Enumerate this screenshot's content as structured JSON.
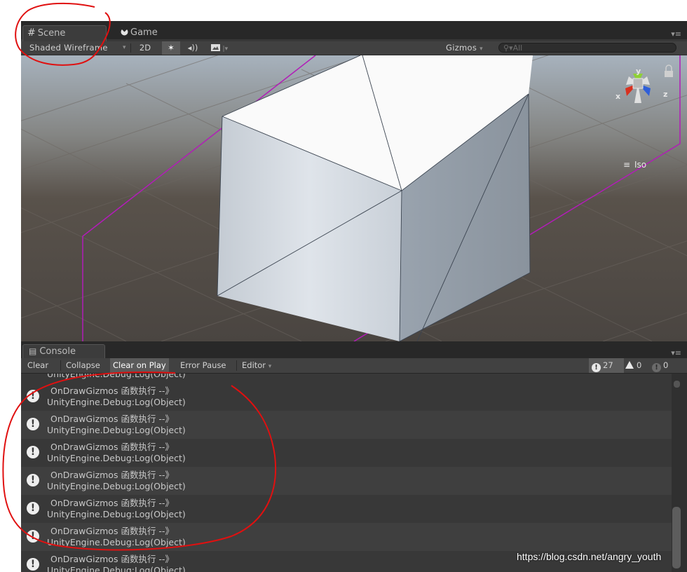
{
  "scene_panel": {
    "tabs": [
      {
        "label": "Scene",
        "icon": "grid-icon",
        "active": true
      },
      {
        "label": "Game",
        "icon": "pacman-icon",
        "active": false
      }
    ],
    "toolbar": {
      "shading_mode": "Shaded Wireframe",
      "mode_2d": "2D",
      "lighting_icon": "sun-icon",
      "audio_icon": "speaker-icon",
      "effects_icon": "image-icon",
      "gizmos_label": "Gizmos",
      "search_placeholder": "All"
    },
    "orientation_gizmo": {
      "axes": [
        "y",
        "x",
        "z"
      ],
      "projection_label": "Iso",
      "axis_colors": {
        "x": "#d9311f",
        "y": "#8fd035",
        "z": "#2f5fd8"
      }
    }
  },
  "console_panel": {
    "tab_label": "Console",
    "toolbar": {
      "clear": "Clear",
      "collapse": "Collapse",
      "clear_on_play": "Clear on Play",
      "error_pause": "Error Pause",
      "editor": "Editor"
    },
    "counts": {
      "log": "27",
      "warning": "0",
      "error": "0"
    },
    "partial_top_line": "UnityEngine.Debug:Log(Object)",
    "entries": [
      {
        "message": "OnDrawGizmos 函数执行 --》",
        "trace": "UnityEngine.Debug:Log(Object)"
      },
      {
        "message": "OnDrawGizmos 函数执行 --》",
        "trace": "UnityEngine.Debug:Log(Object)"
      },
      {
        "message": "OnDrawGizmos 函数执行 --》",
        "trace": "UnityEngine.Debug:Log(Object)"
      },
      {
        "message": "OnDrawGizmos 函数执行 --》",
        "trace": "UnityEngine.Debug:Log(Object)"
      },
      {
        "message": "OnDrawGizmos 函数执行 --》",
        "trace": "UnityEngine.Debug:Log(Object)"
      },
      {
        "message": "OnDrawGizmos 函数执行 --》",
        "trace": "UnityEngine.Debug:Log(Object)"
      },
      {
        "message": "OnDrawGizmos 函数执行 --》",
        "trace": "UnityEngine.Debug:Log(Object)"
      }
    ]
  },
  "watermark": "https://blog.csdn.net/angry_youth",
  "colors": {
    "annotation_red": "#e01010",
    "gizmo_line": "#b21cb8",
    "panel_bg": "#383838"
  }
}
